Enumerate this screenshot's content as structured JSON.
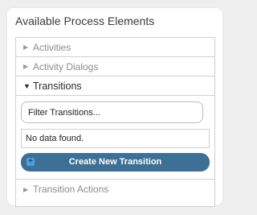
{
  "panel": {
    "title": "Available Process Elements"
  },
  "sections": [
    {
      "label": "Activities",
      "expanded": false,
      "icon": "triangle-right-icon"
    },
    {
      "label": "Activity Dialogs",
      "expanded": false,
      "icon": "triangle-right-icon"
    },
    {
      "label": "Transitions",
      "expanded": true,
      "icon": "triangle-down-icon"
    },
    {
      "label": "Transition Actions",
      "expanded": false,
      "icon": "triangle-right-icon"
    }
  ],
  "transitions": {
    "filter_placeholder": "Filter Transitions...",
    "empty_message": "No data found.",
    "create_button_label": "Create New Transition",
    "create_button_icon": "plus-icon"
  },
  "colors": {
    "button_bg": "#3e6f94",
    "plus_icon_bg": "#4e9fe0",
    "border": "#d0d0d0",
    "page_bg": "#efefef"
  }
}
